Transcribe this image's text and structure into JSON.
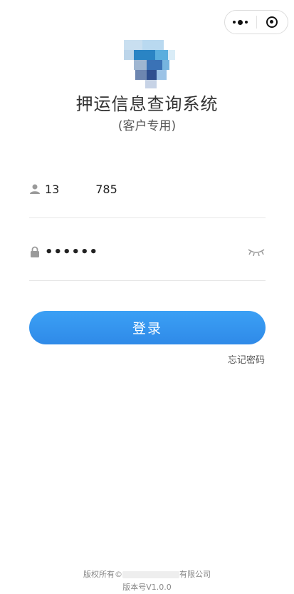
{
  "capsule": {
    "more_icon": "more-dots-icon",
    "close_icon": "target-icon"
  },
  "app": {
    "title": "押运信息查询系统",
    "subtitle": "(客户专用)"
  },
  "login": {
    "username": "13          785",
    "password_mask": "••••••",
    "submit_label": "登录",
    "forgot_label": "忘记密码"
  },
  "footer": {
    "copyright_prefix": "版权所有©",
    "copyright_suffix": "有限公司",
    "version": "版本号V1.0.0"
  },
  "colors": {
    "accent": "#2f8ae8",
    "text": "#333333"
  }
}
